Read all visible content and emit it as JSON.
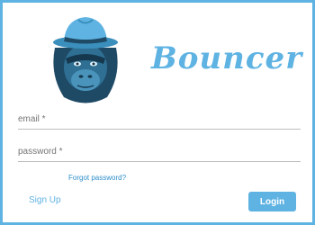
{
  "brand": {
    "name": "Bouncer",
    "logo_icon": "gorilla-with-fedora-icon"
  },
  "form": {
    "email_label": "email *",
    "password_label": "password *",
    "forgot_password": "Forgot password?",
    "sign_up": "Sign Up",
    "login": "Login"
  },
  "colors": {
    "accent": "#5fb3e2",
    "link": "#2e8fc9",
    "mascot_dark": "#1f4a66",
    "mascot_mid": "#2e6f93"
  }
}
